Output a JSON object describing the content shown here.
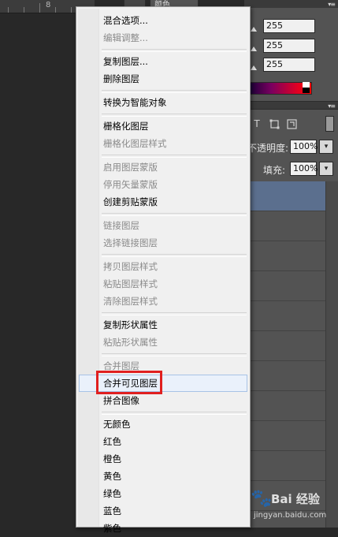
{
  "ruler": {
    "number": "8"
  },
  "color_panel": {
    "tab_label": "颜色",
    "r_value": "255",
    "g_value": "255",
    "b_value": "255",
    "menu_icon": "panel-menu-icon"
  },
  "layers_panel": {
    "opacity_label": "不透明度:",
    "opacity_value": "100%",
    "fill_label": "填充:",
    "fill_value": "100%",
    "filter_icons": [
      "type-filter-icon",
      "shape-filter-icon",
      "smart-object-filter-icon"
    ]
  },
  "context_menu": {
    "items": [
      {
        "label": "混合选项...",
        "disabled": false
      },
      {
        "label": "编辑调整...",
        "disabled": true
      },
      {
        "label": "复制图层...",
        "disabled": false
      },
      {
        "label": "删除图层",
        "disabled": false
      },
      {
        "label": "转换为智能对象",
        "disabled": false
      },
      {
        "label": "栅格化图层",
        "disabled": false
      },
      {
        "label": "栅格化图层样式",
        "disabled": true
      },
      {
        "label": "启用图层蒙版",
        "disabled": true
      },
      {
        "label": "停用矢量蒙版",
        "disabled": true
      },
      {
        "label": "创建剪贴蒙版",
        "disabled": false
      },
      {
        "label": "链接图层",
        "disabled": true
      },
      {
        "label": "选择链接图层",
        "disabled": true
      },
      {
        "label": "拷贝图层样式",
        "disabled": true
      },
      {
        "label": "粘贴图层样式",
        "disabled": true
      },
      {
        "label": "清除图层样式",
        "disabled": true
      },
      {
        "label": "复制形状属性",
        "disabled": false
      },
      {
        "label": "粘贴形状属性",
        "disabled": true
      },
      {
        "label": "合并图层",
        "disabled": true
      },
      {
        "label": "合并可见图层",
        "disabled": false,
        "hovered": true
      },
      {
        "label": "拼合图像",
        "disabled": false
      },
      {
        "label": "无颜色",
        "disabled": false
      },
      {
        "label": "红色",
        "disabled": false
      },
      {
        "label": "橙色",
        "disabled": false
      },
      {
        "label": "黄色",
        "disabled": false
      },
      {
        "label": "绿色",
        "disabled": false
      },
      {
        "label": "蓝色",
        "disabled": false
      },
      {
        "label": "紫色",
        "disabled": false
      }
    ]
  },
  "highlight_color": "#e02020",
  "watermark": {
    "brand": "Bai 经验",
    "url": "jingyan.baidu.com"
  }
}
